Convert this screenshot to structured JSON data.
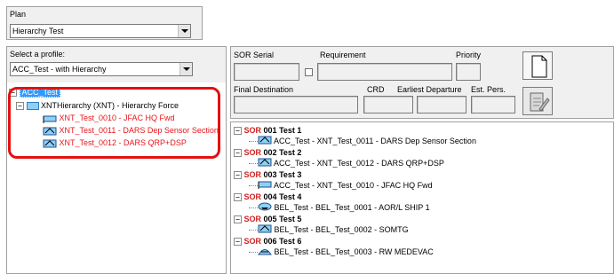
{
  "plan": {
    "label": "Plan",
    "value": "Hierarchy Test"
  },
  "profile": {
    "label": "Select a profile:",
    "value": "ACC_Test - with Hierarchy"
  },
  "left_tree": {
    "root": "ACC_Test",
    "hierarchy": "XNTHierarchy (XNT) - Hierarchy Force",
    "children": [
      "XNT_Test_0010 - JFAC HQ Fwd",
      "XNT_Test_0011 - DARS Dep Sensor Section",
      "XNT_Test_0012 - DARS QRP+DSP"
    ]
  },
  "detail": {
    "sor_serial": "SOR Serial",
    "requirement": "Requirement",
    "priority": "Priority",
    "final_destination": "Final Destination",
    "crd": "CRD",
    "earliest_departure": "Earliest Departure",
    "est_pers": "Est. Pers."
  },
  "sor_tree": [
    {
      "tag": "SOR",
      "title": "001 Test 1",
      "child": "ACC_Test - XNT_Test_0011 - DARS Dep Sensor Section",
      "icon": "unit-icon"
    },
    {
      "tag": "SOR",
      "title": "002 Test 2",
      "child": "ACC_Test - XNT_Test_0012 - DARS QRP+DSP",
      "icon": "unit-icon"
    },
    {
      "tag": "SOR",
      "title": "003 Test 3",
      "child": "ACC_Test - XNT_Test_0010 - JFAC HQ Fwd",
      "icon": "flag-icon"
    },
    {
      "tag": "SOR",
      "title": "004 Test 4",
      "child": "BEL_Test - BEL_Test_0001 - AOR/L SHIP 1",
      "icon": "ship-icon"
    },
    {
      "tag": "SOR",
      "title": "005 Test 5",
      "child": "BEL_Test - BEL_Test_0002 - SOMTG",
      "icon": "unit-icon"
    },
    {
      "tag": "SOR",
      "title": "006 Test 6",
      "child": "BEL_Test - BEL_Test_0003 - RW MEDEVAC",
      "icon": "helicopter-icon"
    }
  ]
}
